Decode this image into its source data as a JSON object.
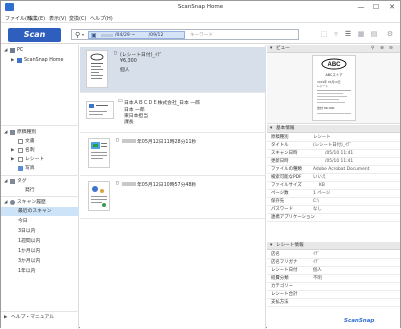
{
  "window": {
    "title": "ScanSnap Home",
    "minimize": "—",
    "maximize": "☐",
    "close": "✕"
  },
  "menu": [
    "ファイル(F)",
    "編集(E)",
    "表示(V)",
    "変換(C)",
    "ヘルプ(H)"
  ],
  "toolbar": {
    "scan_label": "Scan",
    "date_from": "/04/29",
    "date_sep": "~",
    "date_to": "/09/12",
    "keyword_placeholder": "キーワード"
  },
  "sidebar": {
    "pc_label": "PC",
    "scansnap_home_label": "ScanSnap Home",
    "doc_types_label": "原稿種別",
    "doc_types": [
      "文書",
      "名刺",
      "レシート",
      "写真"
    ],
    "tags_label": "タグ",
    "tag_items": [
      "発行"
    ],
    "scan_history_label": "スキャン履歴",
    "scan_history": [
      "最近のスキャン",
      "今日",
      "3日以内",
      "1週間以内",
      "1か月以内",
      "3か月以内",
      "1年以内"
    ],
    "help_label": "ヘルプ・マニュアル"
  },
  "list": {
    "items": [
      {
        "title": "(レシート日付)_ｲﾃﾞ",
        "line2": "¥6,300",
        "line3": "個人"
      },
      {
        "title": "日本ＡＢＣＤＥ株式会社_日本 一郎",
        "line2": "日本 一郎",
        "line3": "東日本担当",
        "line4": "課長"
      },
      {
        "title": "年05月12日11時28分11秒"
      },
      {
        "title": "年05月12日10時57分48秒"
      }
    ]
  },
  "receipt_preview": {
    "logo": "ABC",
    "store": "ABCストア",
    "lines": [
      "2019年 05月10日",
      "レシート",
      "合計 ¥6,300"
    ]
  },
  "panels": {
    "view_label": "ビュー",
    "basic_label": "基本情報",
    "receipt_label": "レシート情報"
  },
  "basic_info": [
    {
      "k": "原稿種別",
      "v": "レシート"
    },
    {
      "k": "タイトル",
      "v": "(レシート日付)_ｲﾃﾞ"
    },
    {
      "k": "スキャン日時",
      "v": "/05/10 11:41"
    },
    {
      "k": "更新日時",
      "v": "/05/10 11:41"
    },
    {
      "k": "ファイルの種類",
      "v": "Adobe Acrobat Document"
    },
    {
      "k": "検索可能なPDF",
      "v": "いいえ"
    },
    {
      "k": "ファイルサイズ",
      "v": "KB"
    },
    {
      "k": "ページ数",
      "v": "1 ページ"
    },
    {
      "k": "保存先",
      "v": "C:\\"
    },
    {
      "k": "パスワード",
      "v": "なし"
    },
    {
      "k": "連携アプリケーション",
      "v": ""
    }
  ],
  "receipt_info": [
    {
      "k": "店名",
      "v": "ｲﾃﾞ"
    },
    {
      "k": "店名フリガナ",
      "v": "ｲﾃﾞ"
    },
    {
      "k": "レシート日付",
      "v": "個人"
    },
    {
      "k": "経費分類",
      "v": "不明"
    },
    {
      "k": "カテゴリー",
      "v": ""
    },
    {
      "k": "レシート合計",
      "v": ""
    },
    {
      "k": "支払方法",
      "v": ""
    }
  ],
  "brand": "ScanSnap",
  "colors": {
    "accent": "#2e5fbf",
    "selection": "#cde3f7"
  }
}
